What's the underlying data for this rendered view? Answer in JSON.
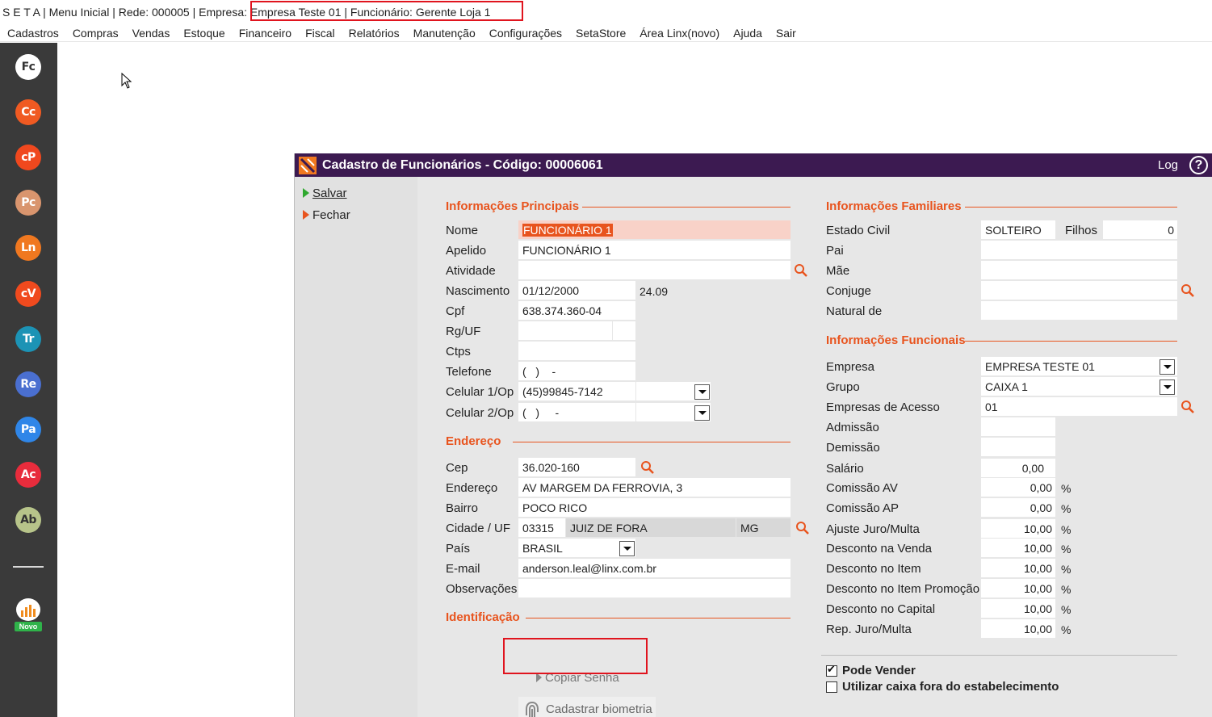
{
  "titlebar": {
    "text_left": "S E T A | Menu Inicial | Rede: 000005 | Empresa: ",
    "text_highlight": "Empresa Teste  01 | Funcionário: Gerente Loja 1"
  },
  "menu": [
    "Cadastros",
    "Compras",
    "Vendas",
    "Estoque",
    "Financeiro",
    "Fiscal",
    "Relatórios",
    "Manutenção",
    "Configurações",
    "SetaStore",
    "Área Linx(novo)",
    "Ajuda",
    "Sair"
  ],
  "sidebar": {
    "buttons": [
      {
        "label": "Fc",
        "color": "#ffffff",
        "text_color": "#333333"
      },
      {
        "label": "Cc",
        "color": "#f05a22"
      },
      {
        "label": "cP",
        "color": "#f0481e"
      },
      {
        "label": "Pc",
        "color": "#d9956e"
      },
      {
        "label": "Ln",
        "color": "#f07820"
      },
      {
        "label": "cV",
        "color": "#f04a1e"
      },
      {
        "label": "Tr",
        "color": "#1c93b5"
      },
      {
        "label": "Re",
        "color": "#4a6fd0"
      },
      {
        "label": "Pa",
        "color": "#2f86e8"
      },
      {
        "label": "Ac",
        "color": "#e82c3c"
      },
      {
        "label": "Ab",
        "color": "#b7c48a",
        "text_color": "#333333"
      }
    ],
    "novo_label": "Novo"
  },
  "dialog": {
    "title": "Cadastro de Funcionários - Código: 00006061",
    "log_label": "Log",
    "help_label": "?",
    "actions": {
      "save": "Salvar",
      "close": "Fechar"
    }
  },
  "principal": {
    "section": "Informações Principais",
    "nome_label": "Nome",
    "nome_value": "FUNCIONÁRIO 1",
    "apelido_label": "Apelido",
    "apelido_value": "FUNCIONÁRIO 1",
    "atividade_label": "Atividade",
    "atividade_value": "",
    "nascimento_label": "Nascimento",
    "nascimento_value": "01/12/2000",
    "idade_value": "24.09",
    "cpf_label": "Cpf",
    "cpf_value": "638.374.360-04",
    "rg_label": "Rg/UF",
    "rg_value": "",
    "ctps_label": "Ctps",
    "ctps_value": "",
    "telefone_label": "Telefone",
    "telefone_value": "(   )    -",
    "celular1_label": "Celular 1/Op",
    "celular1_value": "(45)99845-7142",
    "celular2_label": "Celular 2/Op",
    "celular2_value": "(   )     -"
  },
  "endereco": {
    "section": "Endereço",
    "cep_label": "Cep",
    "cep_value": "36.020-160",
    "endereco_label": "Endereço",
    "endereco_value": "AV MARGEM DA FERROVIA, 3",
    "bairro_label": "Bairro",
    "bairro_value": "POCO RICO",
    "cidade_label": "Cidade / UF",
    "cidade_code": "03315",
    "cidade_name": "JUIZ DE FORA",
    "uf": "MG",
    "pais_label": "País",
    "pais_value": "BRASIL",
    "email_label": "E-mail",
    "email_value": "anderson.leal@linx.com.br",
    "obs_label": "Observações",
    "obs_value": ""
  },
  "identificacao": {
    "section": "Identificação",
    "copy_button": "Copiar Senha",
    "bio_button": "Cadastrar biometria"
  },
  "familiares": {
    "section": "Informações Familiares",
    "estado_civil_label": "Estado Civil",
    "estado_civil_value": "SOLTEIRO",
    "filhos_label": "Filhos",
    "filhos_value": "0",
    "pai_label": "Pai",
    "pai_value": "",
    "mae_label": "Mãe",
    "mae_value": "",
    "conjuge_label": "Conjuge",
    "conjuge_value": "",
    "natural_label": "Natural de",
    "natural_value": ""
  },
  "funcionais": {
    "section": "Informações Funcionais",
    "empresa_label": "Empresa",
    "empresa_value": "EMPRESA TESTE  01",
    "grupo_label": "Grupo",
    "grupo_value": "CAIXA 1",
    "acesso_label": "Empresas de Acesso",
    "acesso_value": "01",
    "admissao_label": "Admissão",
    "admissao_value": "",
    "demissao_label": "Demissão",
    "demissao_value": "",
    "salario_label": "Salário",
    "salario_value": "0,00",
    "pct_symbol": "%",
    "pct_rows": [
      {
        "label": "Comissão AV",
        "value": "0,00"
      },
      {
        "label": "Comissão AP",
        "value": "0,00"
      },
      {
        "label": "Ajuste Juro/Multa",
        "value": "10,00"
      },
      {
        "label": "Desconto na Venda",
        "value": "10,00"
      },
      {
        "label": "Desconto no Item",
        "value": "10,00"
      },
      {
        "label": "Desconto no Item Promoção",
        "value": "10,00"
      },
      {
        "label": "Desconto no Capital",
        "value": "10,00"
      },
      {
        "label": "Rep. Juro/Multa",
        "value": "10,00"
      }
    ],
    "pode_vender_label": "Pode Vender",
    "pode_vender": true,
    "caixa_fora_label": "Utilizar caixa fora do estabelecimento",
    "caixa_fora": false
  }
}
